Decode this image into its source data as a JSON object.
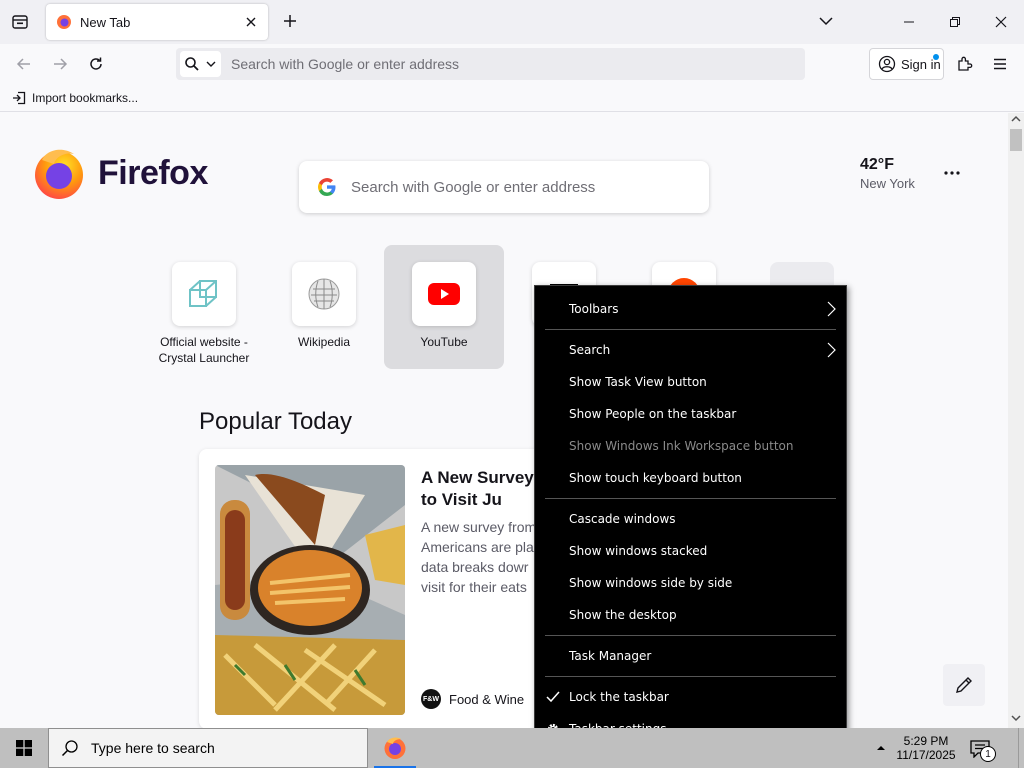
{
  "browser": {
    "tab_title": "New Tab",
    "urlbar_placeholder": "Search with Google or enter address",
    "signin_label": "Sign in",
    "bookmarks_import": "Import bookmarks..."
  },
  "newtab": {
    "logo_text": "Firefox",
    "search_placeholder": "Search with Google or enter address",
    "weather": {
      "temp": "42°F",
      "city": "New York"
    },
    "top_sites": [
      {
        "label": "Official website - Crystal Launcher",
        "icon": "crystal-launcher-icon"
      },
      {
        "label": "Wikipedia",
        "icon": "wikipedia-icon"
      },
      {
        "label": "YouTube",
        "icon": "youtube-icon"
      }
    ],
    "popular_title": "Popular Today",
    "story": {
      "title": "A New Survey Want to Visit Ju",
      "excerpt": "A new survey from Americans are pla data breaks dowr visit for their eats",
      "source": "Food & Wine",
      "source_logo": "F&W"
    }
  },
  "context_menu": {
    "items": [
      {
        "label": "Toolbars",
        "submenu": true
      },
      {
        "label": "Search",
        "submenu": true
      },
      {
        "label": "Show Task View button"
      },
      {
        "label": "Show People on the taskbar"
      },
      {
        "label": "Show Windows Ink Workspace button",
        "disabled": true
      },
      {
        "label": "Show touch keyboard button"
      },
      {
        "label": "Cascade windows"
      },
      {
        "label": "Show windows stacked"
      },
      {
        "label": "Show windows side by side"
      },
      {
        "label": "Show the desktop"
      },
      {
        "label": "Task Manager"
      },
      {
        "label": "Lock the taskbar",
        "checked": true
      },
      {
        "label": "Taskbar settings",
        "icon": "gear-icon"
      }
    ]
  },
  "taskbar": {
    "search_placeholder": "Type here to search",
    "time": "5:29 PM",
    "date": "11/17/2025",
    "notification_count": "1"
  },
  "colors": {
    "youtube_red": "#ff0000",
    "firefox_purple": "#20123a",
    "menu_bg": "#000000",
    "taskbar_bg": "#bfbfbf"
  }
}
